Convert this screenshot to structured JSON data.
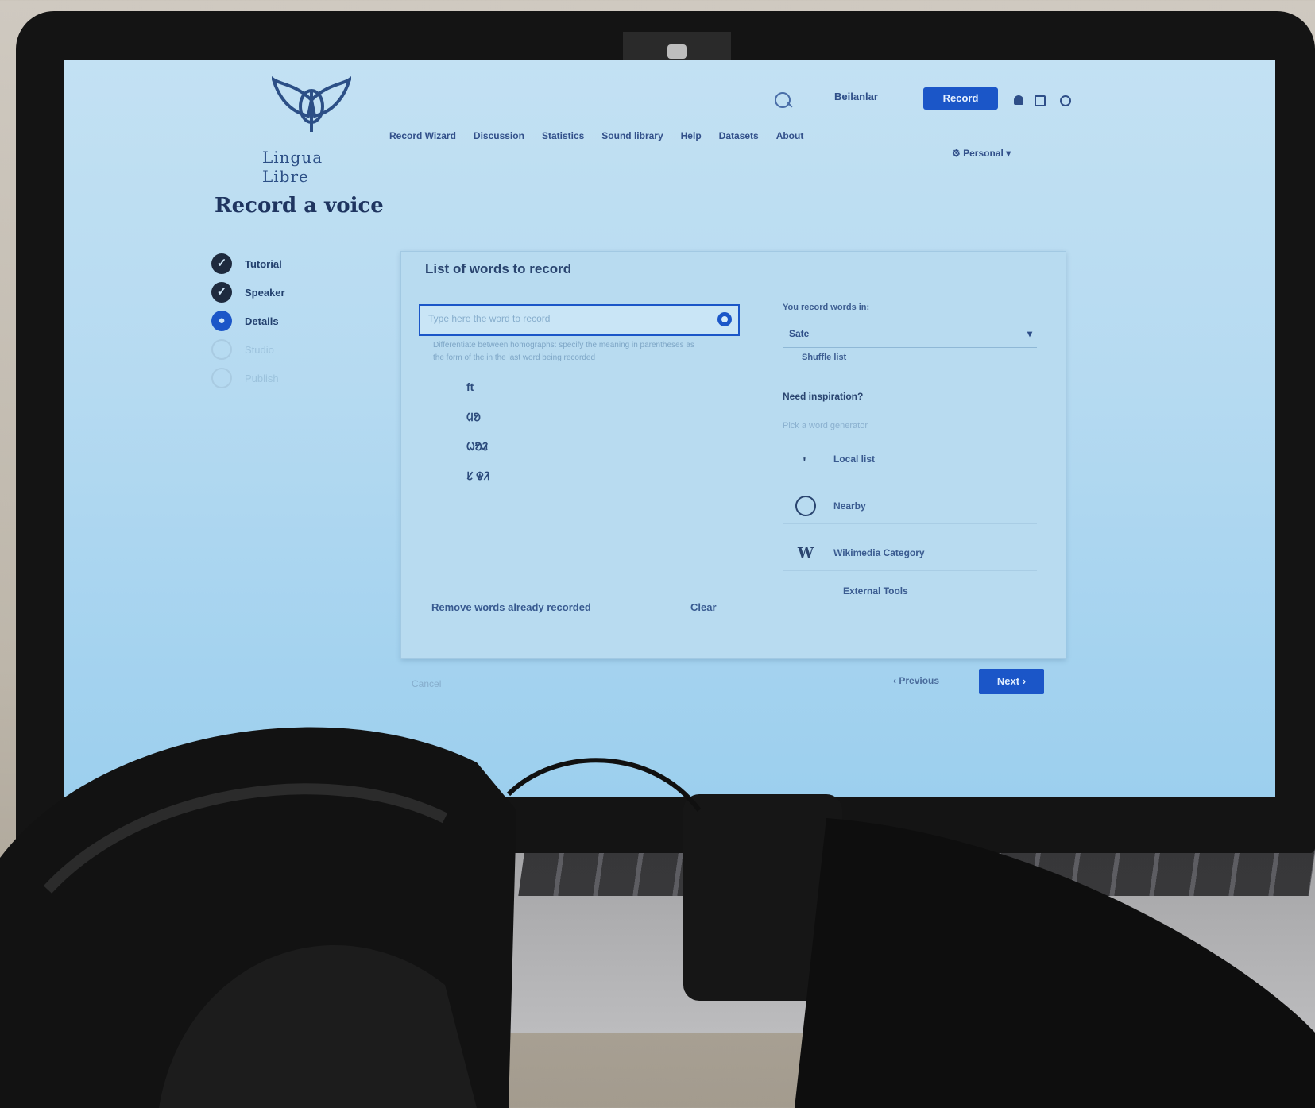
{
  "app": {
    "brand": "Lingua Libre",
    "language_selector": "Beilanlar",
    "record_button": "Record",
    "nav": [
      "Record Wizard",
      "Discussion",
      "Statistics",
      "Sound library",
      "Help",
      "Datasets",
      "About"
    ],
    "profile_menu": "Personal"
  },
  "page": {
    "title": "Record a voice",
    "steps": [
      {
        "label": "Tutorial",
        "state": "done"
      },
      {
        "label": "Speaker",
        "state": "done"
      },
      {
        "label": "Details",
        "state": "active"
      },
      {
        "label": "Studio",
        "state": "pending"
      },
      {
        "label": "Publish",
        "state": "pending"
      }
    ]
  },
  "card": {
    "title": "List of words to record",
    "input_placeholder": "Type here the word to record",
    "hint": "Differentiate between homographs: specify the meaning in parentheses as the form of the in the last word being recorded",
    "words": [
      "ft",
      "ᱢᱚ",
      "ᱦᱚᱲ",
      "ᱥ ᱫᱤ"
    ],
    "remove_link": "Remove words already recorded",
    "clear_link": "Clear"
  },
  "right": {
    "record_in_label": "You record words in:",
    "language_value": "Sate",
    "shuffle_label": "Shuffle list",
    "inspiration_title": "Need inspiration?",
    "inspiration_sub": "Pick a word generator",
    "items": [
      {
        "label": "Local list",
        "icon": "list-icon"
      },
      {
        "label": "Nearby",
        "icon": "compass-icon"
      },
      {
        "label": "Wikimedia Category",
        "icon": "wikipedia-icon"
      }
    ],
    "external_tools": "External Tools"
  },
  "footer": {
    "cancel": "Cancel",
    "previous": "Previous",
    "next": "Next"
  }
}
